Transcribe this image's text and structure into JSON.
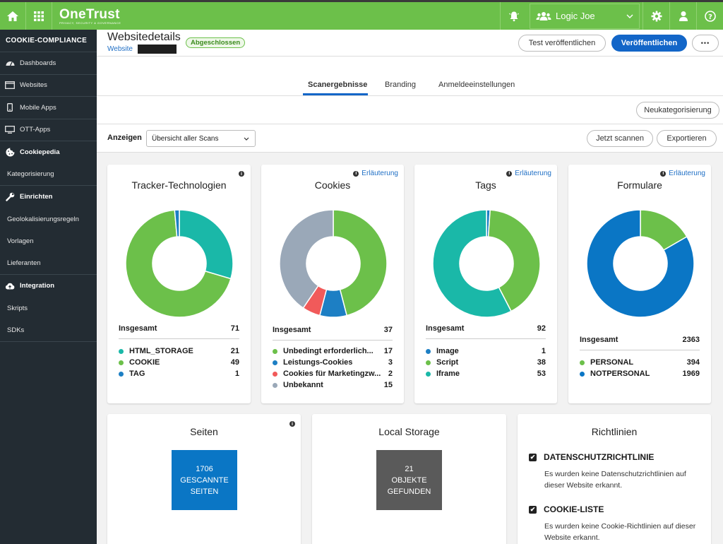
{
  "topbar": {
    "logo_name": "OneTrust",
    "logo_sub": "PRIVACY, SECURITY & GOVERNANCE",
    "user_name": "Logic Joe"
  },
  "sidebar": {
    "title": "COOKIE-COMPLIANCE",
    "items": [
      {
        "label": "Dashboards",
        "icon": "dashboard-icon"
      },
      {
        "label": "Websites",
        "icon": "browser-icon"
      },
      {
        "label": "Mobile Apps",
        "icon": "phone-icon"
      },
      {
        "label": "OTT-Apps",
        "icon": "monitor-icon"
      },
      {
        "label": "Cookiepedia",
        "icon": "cookie-icon"
      },
      {
        "label": "Kategorisierung"
      },
      {
        "label": "Einrichten",
        "icon": "wrench-icon"
      },
      {
        "label": "Geolokalisierungsregeln"
      },
      {
        "label": "Vorlagen"
      },
      {
        "label": "Lieferanten"
      },
      {
        "label": "Integration",
        "icon": "cloud-icon"
      },
      {
        "label": "Skripts"
      },
      {
        "label": "SDKs"
      }
    ]
  },
  "header": {
    "title": "Websitedetails",
    "status_badge": "Abgeschlossen",
    "breadcrumb_link": "Website",
    "test_publish_label": "Test veröffentlichen",
    "publish_label": "Veröffentlichen",
    "more_label": "•••"
  },
  "tabs": [
    {
      "label": "Scanergebnisse",
      "active": true
    },
    {
      "label": "Branding",
      "active": false
    },
    {
      "label": "Anmeldeeinstellungen",
      "active": false
    }
  ],
  "toolbar": {
    "recategorize_label": "Neukategorisierung",
    "show_label": "Anzeigen",
    "select_value": "Übersicht aller Scans",
    "scan_label": "Jetzt scannen",
    "export_label": "Exportieren"
  },
  "explanation_label": "Erläuterung",
  "total_label": "Insgesamt",
  "colors": {
    "green": "#6cc04a",
    "teal": "#1ab8a8",
    "blue": "#1d7fc4",
    "red": "#f15a5a",
    "gray": "#9aa8b8",
    "darkblue": "#0a76c5",
    "brand_primary": "#1366c8"
  },
  "cards": {
    "tracker": {
      "title": "Tracker-Technologien",
      "total": "71",
      "items": [
        {
          "label": "HTML_STORAGE",
          "value": "21",
          "color": "#1ab8a8"
        },
        {
          "label": "COOKIE",
          "value": "49",
          "color": "#6cc04a"
        },
        {
          "label": "TAG",
          "value": "1",
          "color": "#1d7fc4"
        }
      ]
    },
    "cookies": {
      "title": "Cookies",
      "total": "37",
      "items": [
        {
          "label": "Unbedingt erforderlich...",
          "value": "17",
          "color": "#6cc04a"
        },
        {
          "label": "Leistungs-Cookies",
          "value": "3",
          "color": "#1d7fc4"
        },
        {
          "label": "Cookies für Marketingzw...",
          "value": "2",
          "color": "#f15a5a"
        },
        {
          "label": "Unbekannt",
          "value": "15",
          "color": "#9aa8b8"
        }
      ]
    },
    "tags": {
      "title": "Tags",
      "total": "92",
      "items": [
        {
          "label": "Image",
          "value": "1",
          "color": "#1d7fc4"
        },
        {
          "label": "Script",
          "value": "38",
          "color": "#6cc04a"
        },
        {
          "label": "Iframe",
          "value": "53",
          "color": "#1ab8a8"
        }
      ]
    },
    "forms": {
      "title": "Formulare",
      "total": "2363",
      "items": [
        {
          "label": "PERSONAL",
          "value": "394",
          "color": "#6cc04a"
        },
        {
          "label": "NOTPERSONAL",
          "value": "1969",
          "color": "#0a76c5"
        }
      ]
    },
    "pages": {
      "title": "Seiten",
      "count": "1706",
      "line1": "GESCANNTE",
      "line2": "SEITEN",
      "color": "#0a76c5"
    },
    "local_storage": {
      "title": "Local Storage",
      "count": "21",
      "line1": "OBJEKTE",
      "line2": "GEFUNDEN",
      "color": "#5a5a5a"
    },
    "policies": {
      "title": "Richtlinien",
      "items": [
        {
          "heading": "DATENSCHUTZRICHTLINIE",
          "text": "Es wurden keine Datenschutzrichtlinien auf dieser Website erkannt."
        },
        {
          "heading": "COOKIE-LISTE",
          "text": "Es wurden keine Cookie-Richtlinien auf dieser Website erkannt."
        }
      ]
    }
  }
}
